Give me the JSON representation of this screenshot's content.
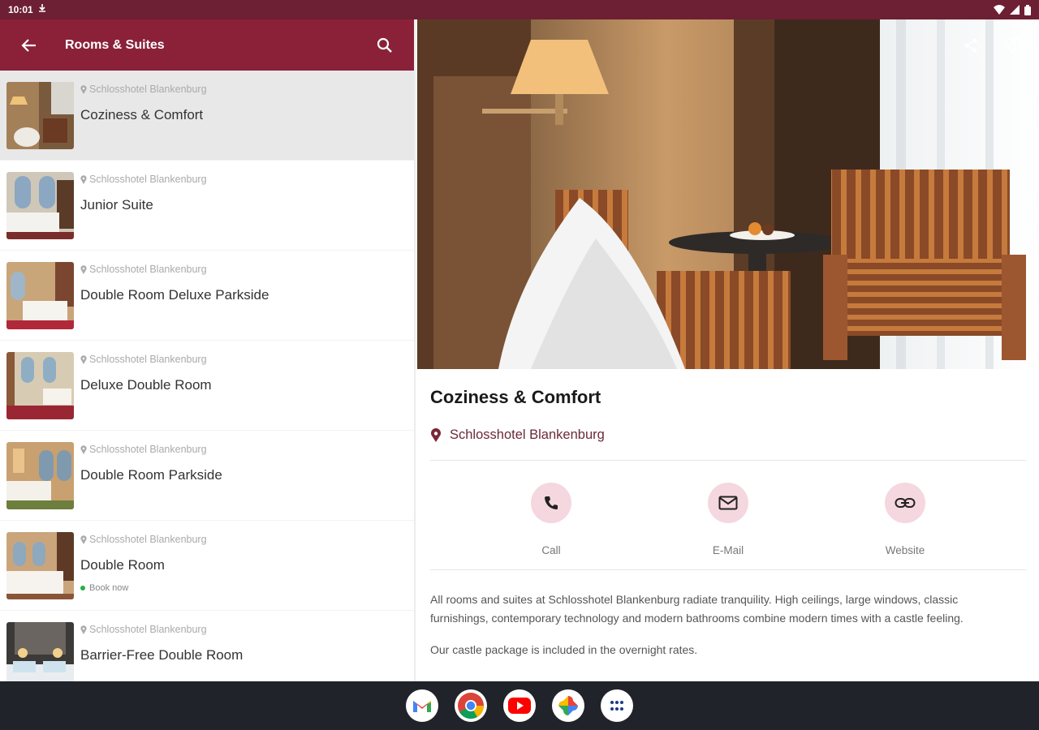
{
  "status_bar": {
    "time": "10:01"
  },
  "app_bar": {
    "title": "Rooms & Suites"
  },
  "list": [
    {
      "location": "Schlosshotel Blankenburg",
      "title": "Coziness & Comfort",
      "badge": ""
    },
    {
      "location": "Schlosshotel Blankenburg",
      "title": "Junior Suite",
      "badge": ""
    },
    {
      "location": "Schlosshotel Blankenburg",
      "title": "Double Room Deluxe Parkside",
      "badge": ""
    },
    {
      "location": "Schlosshotel Blankenburg",
      "title": "Deluxe Double Room",
      "badge": ""
    },
    {
      "location": "Schlosshotel Blankenburg",
      "title": "Double Room Parkside",
      "badge": ""
    },
    {
      "location": "Schlosshotel Blankenburg",
      "title": "Double Room",
      "badge": "Book now"
    },
    {
      "location": "Schlosshotel Blankenburg",
      "title": "Barrier-Free Double Room",
      "badge": ""
    }
  ],
  "detail": {
    "title": "Coziness & Comfort",
    "location": "Schlosshotel Blankenburg",
    "actions": {
      "call": "Call",
      "email": "E-Mail",
      "website": "Website"
    },
    "description": "All rooms and suites at Schlosshotel Blankenburg radiate tranquility. High ceilings, large windows, classic furnishings, contemporary technology and modern bathrooms combine modern times with a castle feeling.",
    "description2": "Our castle package is included in the overnight rates."
  },
  "colors": {
    "primary": "#8a2139",
    "status_bar": "#6d1f33",
    "action_circle": "#f5d7df",
    "badge_dot": "#22b14c"
  },
  "dock": [
    "gmail-icon",
    "chrome-icon",
    "youtube-icon",
    "photos-icon",
    "apps-icon"
  ]
}
